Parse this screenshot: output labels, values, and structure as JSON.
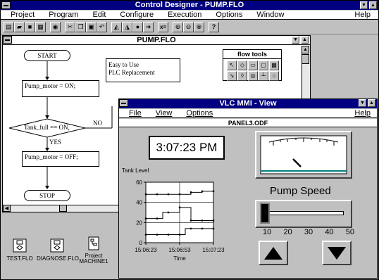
{
  "app": {
    "title": "Control Designer - PUMP.FLO",
    "menu": [
      "Project",
      "Program",
      "Edit",
      "Configure",
      "Execution",
      "Options",
      "Window"
    ],
    "help": "Help",
    "toolbar_icons": [
      "new-icon",
      "open-icon",
      "save-icon",
      "print-icon",
      "find-icon",
      "cut-icon",
      "copy-icon",
      "paste-icon",
      "undo-icon",
      "build-icon",
      "download-icon",
      "run-icon",
      "step-icon",
      "variable-icon",
      "zoom-in-icon",
      "zoom-out-icon",
      "zoom-fit-icon",
      "help-icon"
    ]
  },
  "flow_doc": {
    "title": "PUMP.FLO",
    "start": "START",
    "note_line1": "Easy to Use",
    "note_line2": "PLC Replacement",
    "box1": "Pump_motor = ON;",
    "decision": "Tank_full == ON,",
    "no_label": "NO",
    "yes_label": "YES",
    "box2": "Pump_motor = OFF;",
    "stop": "STOP",
    "tools_title": "flow tools"
  },
  "project_files": [
    {
      "label": "TEST.FLO",
      "icon": "flow-file-icon"
    },
    {
      "label": "DIAGNOSE.FLO",
      "icon": "flow-file-icon"
    },
    {
      "label": "Project",
      "label2": "MACHINE1",
      "icon": "project-icon"
    }
  ],
  "mmi": {
    "title": "VLC MMI - View",
    "menu": [
      "File",
      "View",
      "Options"
    ],
    "help": "Help",
    "panel_title": "PANEL3.ODF",
    "clock": "3:07:23 PM",
    "pump_speed_label": "Pump Speed",
    "slider_ticks": [
      "10",
      "20",
      "30",
      "40",
      "50"
    ],
    "slider_value": 10,
    "gauge_level": 0.3,
    "up_button": "up-arrow",
    "down_button": "down-arrow"
  },
  "chart_data": {
    "type": "line",
    "title": "",
    "ylabel": "Tank Level",
    "xlabel": "Time",
    "ylim": [
      0,
      60
    ],
    "yticks": [
      "0",
      "20",
      "40",
      "60"
    ],
    "xticks": [
      "15:06:23",
      "15:06:53",
      "15:07:23"
    ],
    "x": [
      0,
      5,
      10,
      15,
      20,
      25,
      30,
      35,
      40,
      45,
      50,
      55,
      60
    ],
    "series": [
      {
        "values": [
          48,
          48,
          48,
          48,
          48,
          48,
          48,
          48,
          50,
          50,
          51,
          51,
          51
        ],
        "color": "#000000"
      },
      {
        "values": [
          24,
          24,
          24,
          30,
          30,
          30,
          35,
          35,
          22,
          22,
          22,
          22,
          22
        ],
        "color": "#000000"
      },
      {
        "values": [
          8,
          8,
          8,
          8,
          8,
          8,
          8,
          14,
          14,
          14,
          14,
          14,
          14
        ],
        "color": "#000000"
      }
    ]
  }
}
